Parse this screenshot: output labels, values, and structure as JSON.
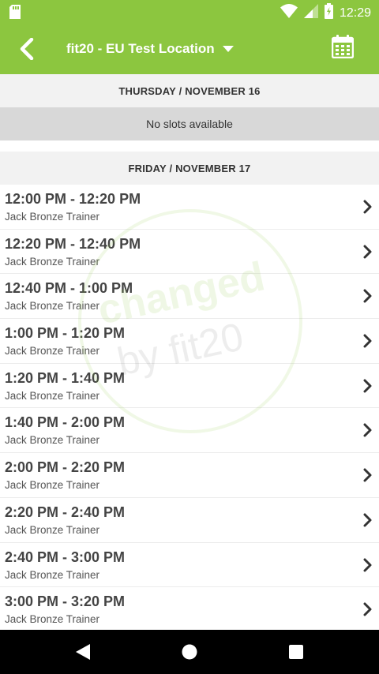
{
  "status_bar": {
    "time": "12:29",
    "icons": [
      "sd-card-icon",
      "wifi-icon",
      "signal-icon",
      "battery-icon"
    ]
  },
  "app_bar": {
    "title": "fit20 - EU Test Location",
    "back_icon": "back-arrow-icon",
    "dropdown_icon": "caret-down-icon",
    "calendar_icon": "calendar-icon"
  },
  "days": [
    {
      "header": "THURSDAY / NOVEMBER 16",
      "empty_text": "No slots available",
      "slots": []
    },
    {
      "header": "FRIDAY / NOVEMBER 17",
      "empty_text": "",
      "slots": [
        {
          "time": "12:00 PM - 12:20 PM",
          "trainer": "Jack Bronze Trainer"
        },
        {
          "time": "12:20 PM - 12:40 PM",
          "trainer": "Jack Bronze Trainer"
        },
        {
          "time": "12:40 PM - 1:00 PM",
          "trainer": "Jack Bronze Trainer"
        },
        {
          "time": "1:00 PM - 1:20 PM",
          "trainer": "Jack Bronze Trainer"
        },
        {
          "time": "1:20 PM - 1:40 PM",
          "trainer": "Jack Bronze Trainer"
        },
        {
          "time": "1:40 PM - 2:00 PM",
          "trainer": "Jack Bronze Trainer"
        },
        {
          "time": "2:00 PM - 2:20 PM",
          "trainer": "Jack Bronze Trainer"
        },
        {
          "time": "2:20 PM - 2:40 PM",
          "trainer": "Jack Bronze Trainer"
        },
        {
          "time": "2:40 PM - 3:00 PM",
          "trainer": "Jack Bronze Trainer"
        },
        {
          "time": "3:00 PM - 3:20 PM",
          "trainer": "Jack Bronze Trainer"
        }
      ]
    }
  ],
  "watermark": {
    "line1": "changed",
    "line2": "by fit20"
  },
  "nav_bar": {
    "icons": [
      "nav-back-icon",
      "nav-home-icon",
      "nav-recents-icon"
    ]
  },
  "colors": {
    "brand": "#8cc63f",
    "header_bg": "#f2f2f2",
    "empty_bg": "#d8d8d8"
  }
}
